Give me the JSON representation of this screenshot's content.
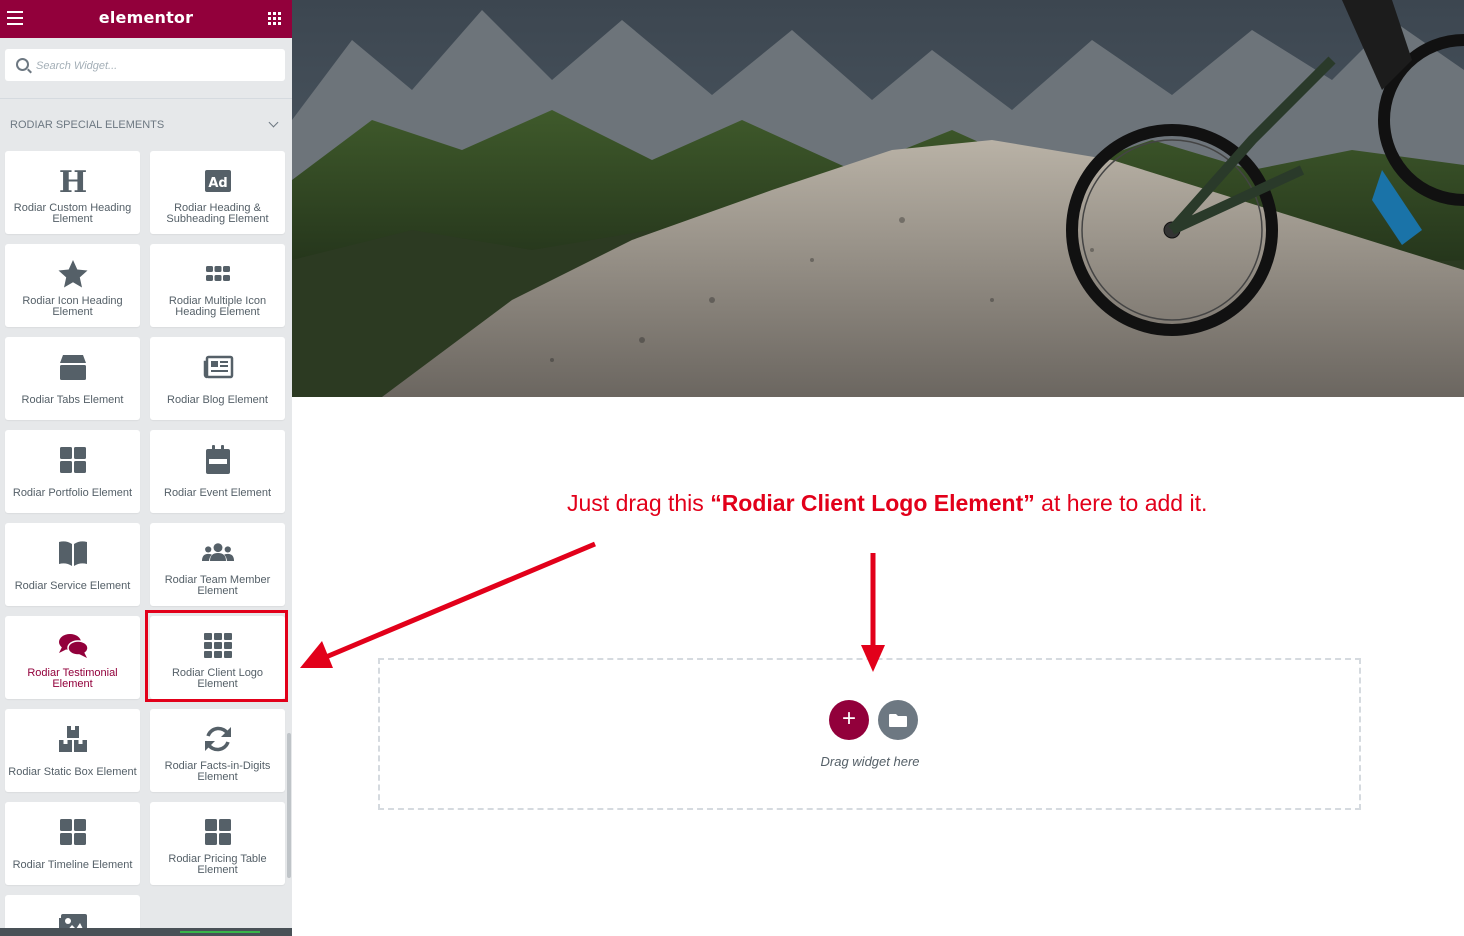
{
  "app": {
    "brand": "elementor"
  },
  "search": {
    "placeholder": "Search Widget..."
  },
  "category": {
    "title": "RODIAR SPECIAL ELEMENTS"
  },
  "widgets": [
    {
      "label": "Rodiar Custom Heading Element",
      "icon": "heading-icon"
    },
    {
      "label": "Rodiar Heading & Subheading Element",
      "icon": "ad-icon"
    },
    {
      "label": "Rodiar Icon Heading Element",
      "icon": "star-icon"
    },
    {
      "label": "Rodiar Multiple Icon Heading Element",
      "icon": "grid-dots-icon"
    },
    {
      "label": "Rodiar Tabs Element",
      "icon": "tabs-box-icon"
    },
    {
      "label": "Rodiar Blog Element",
      "icon": "newspaper-icon"
    },
    {
      "label": "Rodiar Portfolio Element",
      "icon": "th-large-icon"
    },
    {
      "label": "Rodiar Event Element",
      "icon": "calendar-icon"
    },
    {
      "label": "Rodiar Service Element",
      "icon": "book-open-icon"
    },
    {
      "label": "Rodiar Team Member Element",
      "icon": "users-icon"
    },
    {
      "label": "Rodiar Testimonial Element",
      "icon": "comments-icon"
    },
    {
      "label": "Rodiar Client Logo Element",
      "icon": "th-icon"
    },
    {
      "label": "Rodiar Static Box Element",
      "icon": "boxes-icon"
    },
    {
      "label": "Rodiar Facts-in-Digits Element",
      "icon": "sync-icon"
    },
    {
      "label": "Rodiar Timeline Element",
      "icon": "th-large-icon"
    },
    {
      "label": "Rodiar Pricing Table Element",
      "icon": "th-large-icon"
    }
  ],
  "annotation": {
    "prefix": "Just drag this ",
    "highlight": "“Rodiar Client Logo Element”",
    "suffix": " at here to add it."
  },
  "dropzone": {
    "add_label": "+",
    "text": "Drag widget here"
  },
  "colors": {
    "brand": "#92003b",
    "annotation_red": "#e2001a",
    "icon_gray": "#556068"
  }
}
